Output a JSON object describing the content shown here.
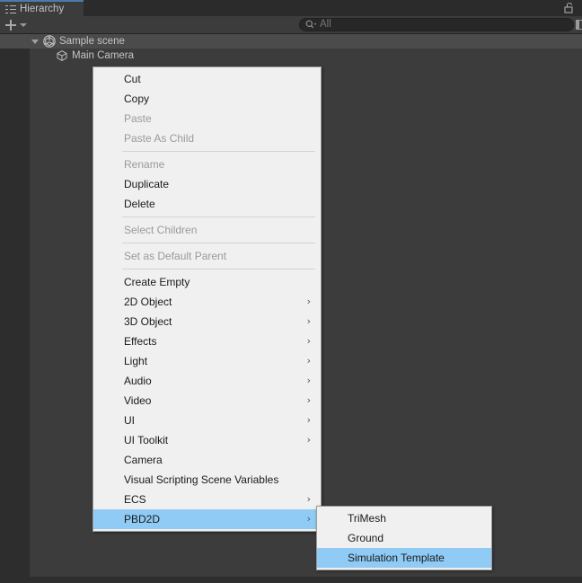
{
  "window": {
    "tab": {
      "label": "Hierarchy",
      "icon": "hierarchy-list-icon"
    },
    "lock_icon": "lock-open-icon"
  },
  "toolbar": {
    "add_button_label": "+",
    "add_button_icon": "plus-icon",
    "add_dropdown_icon": "chevron-down-icon",
    "search": {
      "placeholder": "All",
      "value": "",
      "icon": "search-icon",
      "right_icon": "panel-toggle-icon"
    }
  },
  "hierarchy": {
    "rows": [
      {
        "label": "Sample scene",
        "icon": "unity-scene-icon",
        "depth": 0,
        "expanded": true,
        "highlighted": true
      },
      {
        "label": "Main Camera",
        "icon": "gameobject-cube-icon",
        "depth": 1,
        "expanded": false,
        "highlighted": false
      }
    ]
  },
  "context_menu": {
    "items": [
      {
        "label": "Cut",
        "disabled": false,
        "submenu": false,
        "selected": false
      },
      {
        "label": "Copy",
        "disabled": false,
        "submenu": false,
        "selected": false
      },
      {
        "label": "Paste",
        "disabled": true,
        "submenu": false,
        "selected": false
      },
      {
        "label": "Paste As Child",
        "disabled": true,
        "submenu": false,
        "selected": false
      },
      {
        "separator": true
      },
      {
        "label": "Rename",
        "disabled": true,
        "submenu": false,
        "selected": false
      },
      {
        "label": "Duplicate",
        "disabled": false,
        "submenu": false,
        "selected": false
      },
      {
        "label": "Delete",
        "disabled": false,
        "submenu": false,
        "selected": false
      },
      {
        "separator": true
      },
      {
        "label": "Select Children",
        "disabled": true,
        "submenu": false,
        "selected": false
      },
      {
        "separator": true
      },
      {
        "label": "Set as Default Parent",
        "disabled": true,
        "submenu": false,
        "selected": false
      },
      {
        "separator": true
      },
      {
        "label": "Create Empty",
        "disabled": false,
        "submenu": false,
        "selected": false
      },
      {
        "label": "2D Object",
        "disabled": false,
        "submenu": true,
        "selected": false
      },
      {
        "label": "3D Object",
        "disabled": false,
        "submenu": true,
        "selected": false
      },
      {
        "label": "Effects",
        "disabled": false,
        "submenu": true,
        "selected": false
      },
      {
        "label": "Light",
        "disabled": false,
        "submenu": true,
        "selected": false
      },
      {
        "label": "Audio",
        "disabled": false,
        "submenu": true,
        "selected": false
      },
      {
        "label": "Video",
        "disabled": false,
        "submenu": true,
        "selected": false
      },
      {
        "label": "UI",
        "disabled": false,
        "submenu": true,
        "selected": false
      },
      {
        "label": "UI Toolkit",
        "disabled": false,
        "submenu": true,
        "selected": false
      },
      {
        "label": "Camera",
        "disabled": false,
        "submenu": false,
        "selected": false
      },
      {
        "label": "Visual Scripting Scene Variables",
        "disabled": false,
        "submenu": false,
        "selected": false
      },
      {
        "label": "ECS",
        "disabled": false,
        "submenu": true,
        "selected": false
      },
      {
        "label": "PBD2D",
        "disabled": false,
        "submenu": true,
        "selected": true
      }
    ],
    "submenu_arrow_glyph": "›"
  },
  "submenu": {
    "items": [
      {
        "label": "TriMesh",
        "disabled": false,
        "submenu": false,
        "selected": false
      },
      {
        "label": "Ground",
        "disabled": false,
        "submenu": false,
        "selected": false
      },
      {
        "label": "Simulation Template",
        "disabled": false,
        "submenu": false,
        "selected": true
      }
    ]
  },
  "colors": {
    "editor_background": "#383838",
    "panel_background": "#3c3c3c",
    "tab_bar_background": "#2b2b2b",
    "gutter_background": "#2d2d2d",
    "row_highlight": "#4b4b4b",
    "tab_accent": "#4b7ba8",
    "menu_background": "#f0f0f0",
    "menu_selected": "#8fcbf5",
    "menu_text": "#1a1a1a",
    "menu_text_disabled": "#9a9a9a",
    "tree_text": "#c4c4c4"
  }
}
